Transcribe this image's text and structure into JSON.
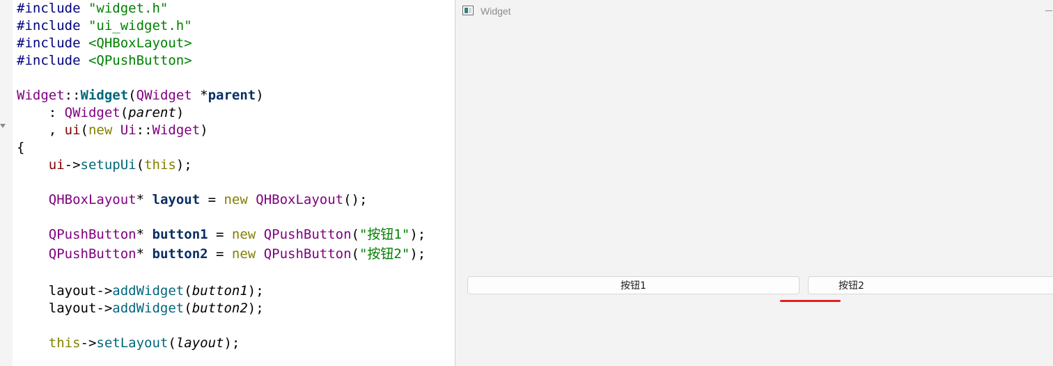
{
  "editor": {
    "lines": [
      [
        {
          "t": "#include ",
          "c": "pp"
        },
        {
          "t": "\"widget.h\"",
          "c": "str"
        }
      ],
      [
        {
          "t": "#include ",
          "c": "pp"
        },
        {
          "t": "\"ui_widget.h\"",
          "c": "str"
        }
      ],
      [
        {
          "t": "#include ",
          "c": "pp"
        },
        {
          "t": "<QHBoxLayout>",
          "c": "inc"
        }
      ],
      [
        {
          "t": "#include ",
          "c": "pp"
        },
        {
          "t": "<QPushButton>",
          "c": "inc"
        }
      ],
      [],
      [
        {
          "t": "Widget",
          "c": "typ"
        },
        {
          "t": "::",
          "c": "plain"
        },
        {
          "t": "Widget",
          "c": "fn"
        },
        {
          "t": "(",
          "c": "plain"
        },
        {
          "t": "QWidget",
          "c": "typ"
        },
        {
          "t": " *",
          "c": "plain"
        },
        {
          "t": "parent",
          "c": "var"
        },
        {
          "t": ")",
          "c": "plain"
        }
      ],
      [
        {
          "t": "    : ",
          "c": "plain"
        },
        {
          "t": "QWidget",
          "c": "typ"
        },
        {
          "t": "(",
          "c": "plain"
        },
        {
          "t": "parent",
          "c": "prm"
        },
        {
          "t": ")",
          "c": "plain"
        }
      ],
      [
        {
          "t": "    , ",
          "c": "plain"
        },
        {
          "t": "ui",
          "c": "mem"
        },
        {
          "t": "(",
          "c": "plain"
        },
        {
          "t": "new",
          "c": "kw"
        },
        {
          "t": " ",
          "c": "plain"
        },
        {
          "t": "Ui",
          "c": "typ"
        },
        {
          "t": "::",
          "c": "plain"
        },
        {
          "t": "Widget",
          "c": "typ"
        },
        {
          "t": ")",
          "c": "plain"
        }
      ],
      [
        {
          "t": "{",
          "c": "plain"
        }
      ],
      [
        {
          "t": "    ",
          "c": "plain"
        },
        {
          "t": "ui",
          "c": "mem"
        },
        {
          "t": "->",
          "c": "plain"
        },
        {
          "t": "setupUi",
          "c": "fnc"
        },
        {
          "t": "(",
          "c": "plain"
        },
        {
          "t": "this",
          "c": "kw"
        },
        {
          "t": ");",
          "c": "plain"
        }
      ],
      [],
      [
        {
          "t": "    ",
          "c": "plain"
        },
        {
          "t": "QHBoxLayout",
          "c": "typ"
        },
        {
          "t": "* ",
          "c": "plain"
        },
        {
          "t": "layout",
          "c": "var"
        },
        {
          "t": " = ",
          "c": "plain"
        },
        {
          "t": "new",
          "c": "kw"
        },
        {
          "t": " ",
          "c": "plain"
        },
        {
          "t": "QHBoxLayout",
          "c": "typ"
        },
        {
          "t": "();",
          "c": "plain"
        }
      ],
      [],
      [
        {
          "t": "    ",
          "c": "plain"
        },
        {
          "t": "QPushButton",
          "c": "typ"
        },
        {
          "t": "* ",
          "c": "plain"
        },
        {
          "t": "button1",
          "c": "var"
        },
        {
          "t": " = ",
          "c": "plain"
        },
        {
          "t": "new",
          "c": "kw"
        },
        {
          "t": " ",
          "c": "plain"
        },
        {
          "t": "QPushButton",
          "c": "typ"
        },
        {
          "t": "(",
          "c": "plain"
        },
        {
          "t": "\"按钮1\"",
          "c": "str"
        },
        {
          "t": ");",
          "c": "plain"
        }
      ],
      [
        {
          "t": "    ",
          "c": "plain"
        },
        {
          "t": "QPushButton",
          "c": "typ"
        },
        {
          "t": "* ",
          "c": "plain"
        },
        {
          "t": "button2",
          "c": "var"
        },
        {
          "t": " = ",
          "c": "plain"
        },
        {
          "t": "new",
          "c": "kw"
        },
        {
          "t": " ",
          "c": "plain"
        },
        {
          "t": "QPushButton",
          "c": "typ"
        },
        {
          "t": "(",
          "c": "plain"
        },
        {
          "t": "\"按钮2\"",
          "c": "str"
        },
        {
          "t": ");",
          "c": "plain"
        }
      ],
      [],
      [
        {
          "t": "    ",
          "c": "plain"
        },
        {
          "t": "layout",
          "c": "plain"
        },
        {
          "t": "->",
          "c": "plain"
        },
        {
          "t": "addWidget",
          "c": "fnc"
        },
        {
          "t": "(",
          "c": "plain"
        },
        {
          "t": "button1",
          "c": "prm"
        },
        {
          "t": ");",
          "c": "plain"
        }
      ],
      [
        {
          "t": "    ",
          "c": "plain"
        },
        {
          "t": "layout",
          "c": "plain"
        },
        {
          "t": "->",
          "c": "plain"
        },
        {
          "t": "addWidget",
          "c": "fnc"
        },
        {
          "t": "(",
          "c": "plain"
        },
        {
          "t": "button2",
          "c": "prm"
        },
        {
          "t": ");",
          "c": "plain"
        }
      ],
      [],
      [
        {
          "t": "    ",
          "c": "plain"
        },
        {
          "t": "this",
          "c": "kw"
        },
        {
          "t": "->",
          "c": "plain"
        },
        {
          "t": "setLayout",
          "c": "fnc"
        },
        {
          "t": "(",
          "c": "plain"
        },
        {
          "t": "layout",
          "c": "prm"
        },
        {
          "t": ");",
          "c": "plain"
        }
      ]
    ]
  },
  "window": {
    "title": "Widget",
    "icon": "window-app-icon",
    "button1_label": "按钮1",
    "button2_label": "按钮2",
    "annotation_color": "#e02020"
  }
}
